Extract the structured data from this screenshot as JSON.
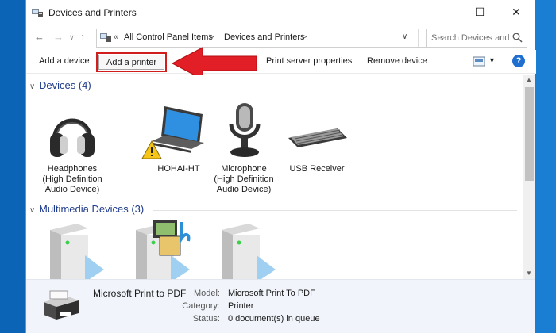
{
  "window": {
    "title": "Devices and Printers",
    "min_glyph": "—",
    "max_glyph": "☐",
    "close_glyph": "✕"
  },
  "navigation": {
    "back_glyph": "←",
    "forward_glyph": "→",
    "up_glyph": "↑",
    "address_chevron": "«",
    "breadcrumbs": [
      "All Control Panel Items",
      "Devices and Printers"
    ],
    "separator": ">",
    "dropdown_glyph": "∨",
    "refresh_glyph": "↻",
    "search_placeholder": "Search Devices and ..."
  },
  "commands": {
    "add_device": "Add a device",
    "add_printer": "Add a printer",
    "print_server_properties": "Print server properties",
    "remove_device": "Remove device",
    "view_dropdown": "▼",
    "help": "?"
  },
  "groups": {
    "devices": {
      "title": "Devices (4)",
      "items": [
        {
          "label": "Headphones\n(High Definition\nAudio Device)",
          "icon": "headphones-icon"
        },
        {
          "label": "HOHAI-HT",
          "icon": "laptop-icon",
          "warning": true
        },
        {
          "label": "Microphone\n(High Definition\nAudio Device)",
          "icon": "microphone-icon"
        },
        {
          "label": "USB Receiver",
          "icon": "keyboard-icon"
        }
      ]
    },
    "multimedia": {
      "title": "Multimedia Devices (3)",
      "items": [
        {
          "icon": "media-server-icon"
        },
        {
          "icon": "media-server-icon"
        },
        {
          "icon": "media-server-icon"
        }
      ]
    }
  },
  "details": {
    "name": "Microsoft Print to PDF",
    "model_label": "Model:",
    "model_value": "Microsoft Print To PDF",
    "category_label": "Category:",
    "category_value": "Printer",
    "status_label": "Status:",
    "status_value": "0 document(s) in queue"
  },
  "colors": {
    "highlight_red": "#d21d1d",
    "group_header": "#1e3a8a",
    "desktop_blue": "#0b64b5"
  }
}
